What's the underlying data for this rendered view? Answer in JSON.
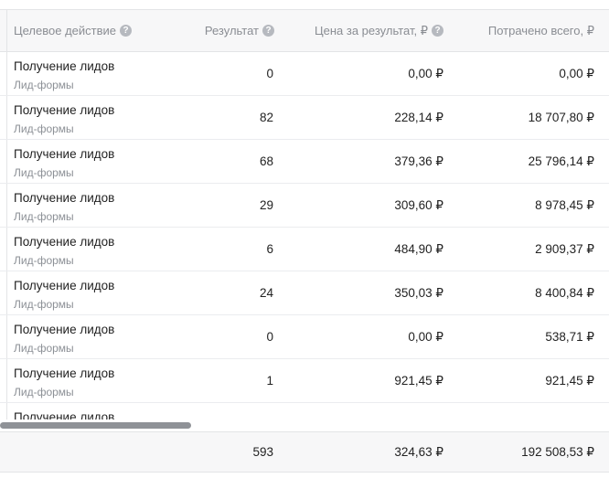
{
  "table": {
    "columns": [
      {
        "label": "Целевое действие",
        "help": "?"
      },
      {
        "label": "Результат",
        "help": "?"
      },
      {
        "label": "Цена за результат, ₽",
        "help": "?"
      },
      {
        "label": "Потрачено всего, ₽",
        "help": ""
      }
    ],
    "rows": [
      {
        "action": "Получение лидов",
        "sub": "Лид-формы",
        "result": "0",
        "price": "0,00 ₽",
        "spent": "0,00 ₽"
      },
      {
        "action": "Получение лидов",
        "sub": "Лид-формы",
        "result": "82",
        "price": "228,14 ₽",
        "spent": "18 707,80 ₽"
      },
      {
        "action": "Получение лидов",
        "sub": "Лид-формы",
        "result": "68",
        "price": "379,36 ₽",
        "spent": "25 796,14 ₽"
      },
      {
        "action": "Получение лидов",
        "sub": "Лид-формы",
        "result": "29",
        "price": "309,60 ₽",
        "spent": "8 978,45 ₽"
      },
      {
        "action": "Получение лидов",
        "sub": "Лид-формы",
        "result": "6",
        "price": "484,90 ₽",
        "spent": "2 909,37 ₽"
      },
      {
        "action": "Получение лидов",
        "sub": "Лид-формы",
        "result": "24",
        "price": "350,03 ₽",
        "spent": "8 400,84 ₽"
      },
      {
        "action": "Получение лидов",
        "sub": "Лид-формы",
        "result": "0",
        "price": "0,00 ₽",
        "spent": "538,71 ₽"
      },
      {
        "action": "Получение лидов",
        "sub": "Лид-формы",
        "result": "1",
        "price": "921,45 ₽",
        "spent": "921,45 ₽"
      },
      {
        "action": "Получение лидов",
        "sub": "",
        "result": "",
        "price": "",
        "spent": ""
      }
    ],
    "totals": {
      "result": "593",
      "price": "324,63 ₽",
      "spent": "192 508,53 ₽"
    }
  },
  "scrollbar": {
    "position": 0,
    "visible_fraction": 0.31
  }
}
